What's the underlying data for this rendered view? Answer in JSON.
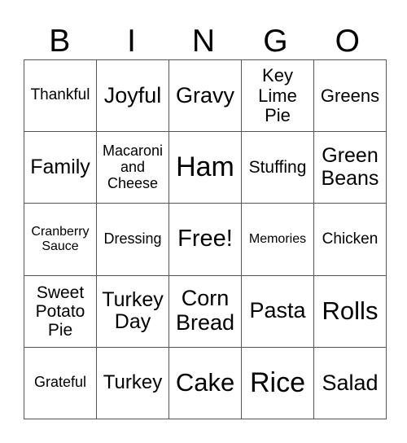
{
  "header": {
    "letters": [
      "B",
      "I",
      "N",
      "G",
      "O"
    ]
  },
  "board": {
    "rows": [
      [
        "Thankful",
        "Joyful",
        "Gravy",
        "Key Lime Pie",
        "Greens"
      ],
      [
        "Family",
        "Macaroni and Cheese",
        "Ham",
        "Stuffing",
        "Green Beans"
      ],
      [
        "Cranberry Sauce",
        "Dressing",
        "Free!",
        "Memories",
        "Chicken"
      ],
      [
        "Sweet Potato Pie",
        "Turkey Day",
        "Corn Bread",
        "Pasta",
        "Rolls"
      ],
      [
        "Grateful",
        "Turkey",
        "Cake",
        "Rice",
        "Salad"
      ]
    ],
    "lines": {
      "r0c3": [
        "Key",
        "Lime",
        "Pie"
      ],
      "r1c1": [
        "Macaroni",
        "and",
        "Cheese"
      ],
      "r1c4": [
        "Green",
        "Beans"
      ],
      "r2c0": [
        "Cranberry",
        "Sauce"
      ],
      "r3c0": [
        "Sweet",
        "Potato",
        "Pie"
      ],
      "r3c1": [
        "Turkey",
        "Day"
      ],
      "r3c2": [
        "Corn",
        "Bread"
      ]
    }
  },
  "colors": {
    "grid_line": "#555555",
    "text": "#000000",
    "background": "#ffffff"
  }
}
